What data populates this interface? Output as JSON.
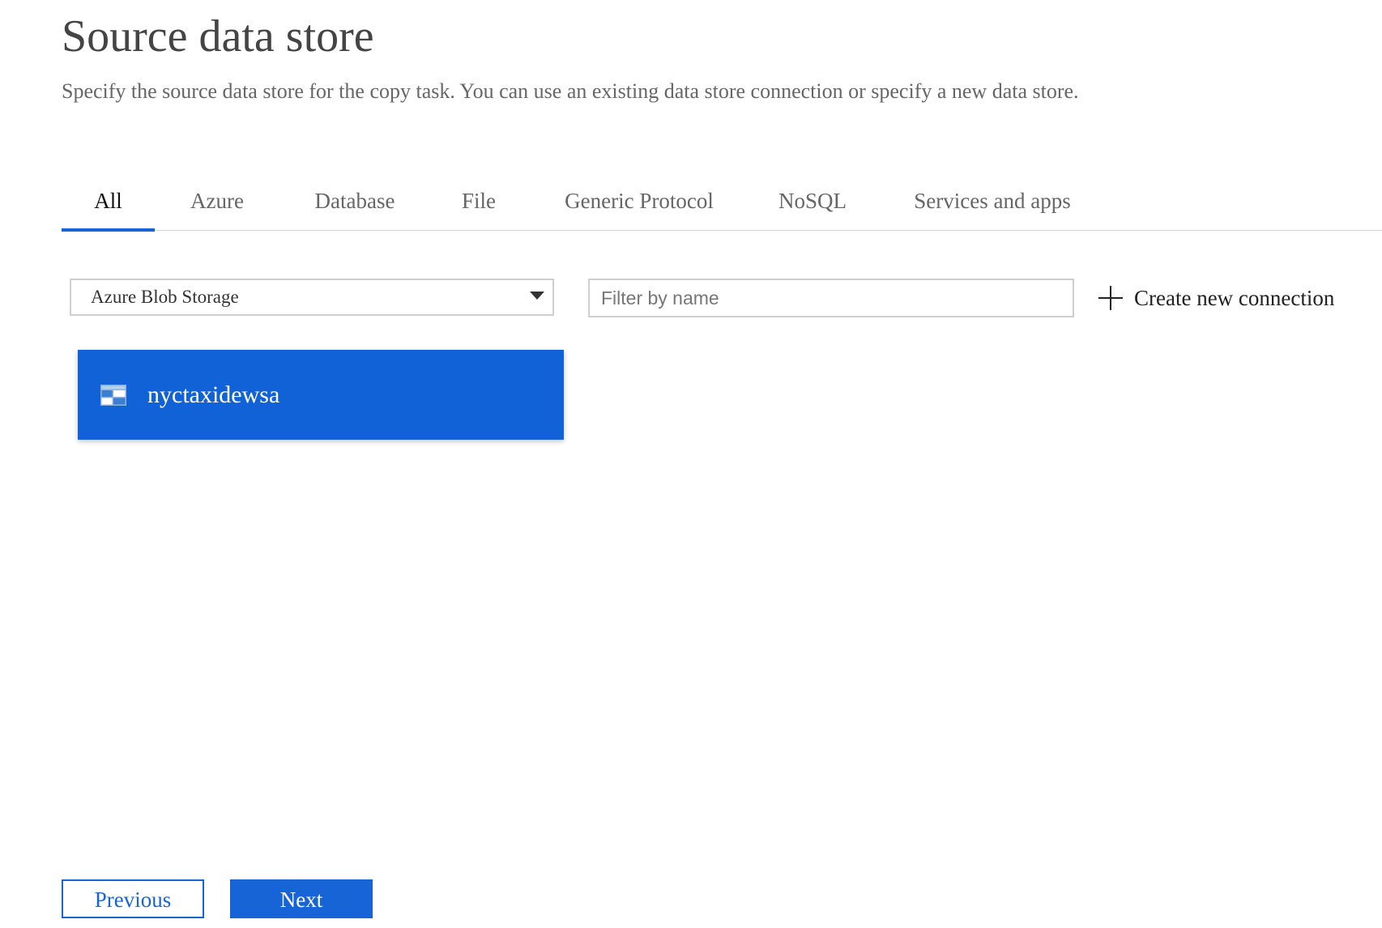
{
  "page": {
    "title": "Source data store",
    "subtitle": "Specify the source data store for the copy task. You can use an existing data store connection or specify a new data store."
  },
  "tabs": [
    {
      "label": "All",
      "active": true
    },
    {
      "label": "Azure",
      "active": false
    },
    {
      "label": "Database",
      "active": false
    },
    {
      "label": "File",
      "active": false
    },
    {
      "label": "Generic Protocol",
      "active": false
    },
    {
      "label": "NoSQL",
      "active": false
    },
    {
      "label": "Services and apps",
      "active": false
    }
  ],
  "filters": {
    "store_type_selected": "Azure Blob Storage",
    "filter_placeholder": "Filter by name",
    "create_label": "Create new connection",
    "create_icon": "plus-icon"
  },
  "connections": [
    {
      "name": "nyctaxidewsa",
      "icon": "storage-account-icon",
      "selected": true
    }
  ],
  "footer": {
    "previous_label": "Previous",
    "next_label": "Next"
  },
  "colors": {
    "accent": "#1764d6",
    "selected_card": "#1062d6"
  }
}
